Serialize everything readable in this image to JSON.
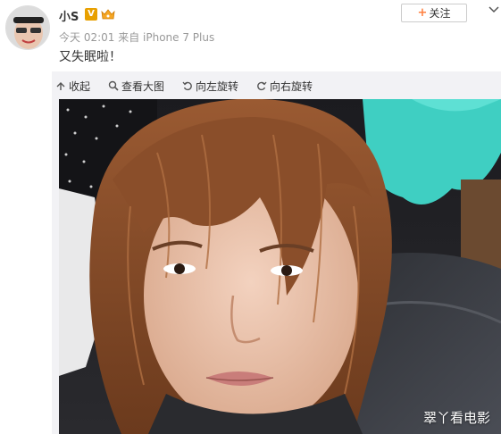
{
  "post": {
    "author": "小S",
    "meta": "今天 02:01 来自 iPhone 7 Plus",
    "text": "又失眠啦！",
    "follow_label": "关注",
    "follow_plus": "+"
  },
  "toolbar": {
    "items": [
      {
        "icon": "collapse-icon",
        "label": "收起"
      },
      {
        "icon": "zoom-icon",
        "label": "查看大图"
      },
      {
        "icon": "rotate-left-icon",
        "label": "向左旋转"
      },
      {
        "icon": "rotate-right-icon",
        "label": "向右旋转"
      }
    ]
  },
  "photo": {
    "watermark": "翠丫看电影"
  },
  "badges": {
    "verified": "V"
  },
  "colors": {
    "verified_badge": "#e8a000",
    "follow_plus": "#ff8140",
    "meta_text": "#999999"
  }
}
